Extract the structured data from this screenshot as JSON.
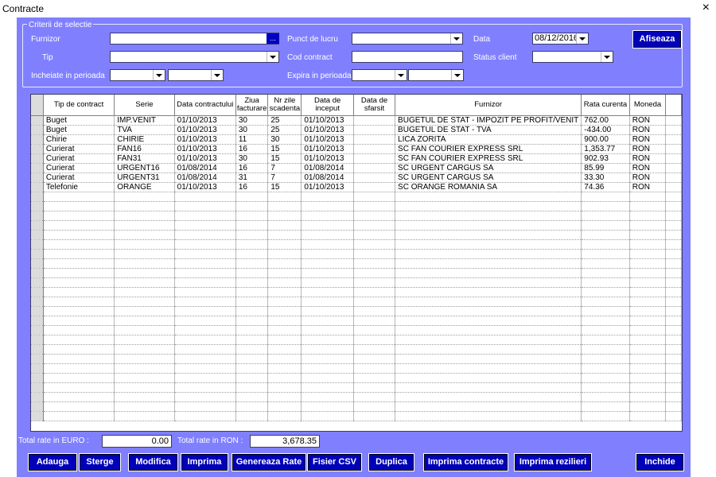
{
  "window": {
    "title": "Contracte",
    "close_symbol": "×"
  },
  "criteria": {
    "legend": "Criterii de selectie",
    "furnizor": {
      "label": "Furnizor",
      "value": "",
      "ellipsis": "..."
    },
    "punct_lucru": {
      "label": "Punct de lucru",
      "value": ""
    },
    "data": {
      "label": "Data",
      "value": "08/12/2016"
    },
    "tip": {
      "label": "Tip",
      "value": ""
    },
    "cod_contract": {
      "label": "Cod contract",
      "value": ""
    },
    "status_client": {
      "label": "Status client",
      "value": ""
    },
    "incheiate": {
      "label": "Incheiate in perioada",
      "from": "",
      "to": ""
    },
    "expira": {
      "label": "Expira in perioada",
      "from": "",
      "to": ""
    },
    "afiseaza_button": "Afiseaza"
  },
  "grid": {
    "columns": [
      "Tip de contract",
      "Serie",
      "Data contractului",
      "Ziua facturare",
      "Nr zile scadenta",
      "Data de inceput",
      "Data de sfarsit",
      "Furnizor",
      "Rata curenta",
      "Moneda"
    ],
    "rows": [
      [
        "Buget",
        "IMP.VENIT",
        "01/10/2013",
        "30",
        "25",
        "01/10/2013",
        "",
        "BUGETUL DE STAT - IMPOZIT PE PROFIT/VENIT",
        "762.00",
        "RON"
      ],
      [
        "Buget",
        "TVA",
        "01/10/2013",
        "30",
        "25",
        "01/10/2013",
        "",
        "BUGETUL DE STAT - TVA",
        "-434.00",
        "RON"
      ],
      [
        "Chirie",
        "CHIRIE",
        "01/10/2013",
        "11",
        "30",
        "01/10/2013",
        "",
        "LICA ZORITA",
        "900.00",
        "RON"
      ],
      [
        "Curierat",
        "FAN16",
        "01/10/2013",
        "16",
        "15",
        "01/10/2013",
        "",
        "SC FAN COURIER EXPRESS SRL",
        "1,353.77",
        "RON"
      ],
      [
        "Curierat",
        "FAN31",
        "01/10/2013",
        "30",
        "15",
        "01/10/2013",
        "",
        "SC FAN COURIER EXPRESS SRL",
        "902.93",
        "RON"
      ],
      [
        "Curierat",
        "URGENT16",
        "01/08/2014",
        "16",
        "7",
        "01/08/2014",
        "",
        "SC URGENT CARGUS SA",
        "85.99",
        "RON"
      ],
      [
        "Curierat",
        "URGENT31",
        "01/08/2014",
        "31",
        "7",
        "01/08/2014",
        "",
        "SC URGENT CARGUS SA",
        "33.30",
        "RON"
      ],
      [
        "Telefonie",
        "ORANGE",
        "01/10/2013",
        "16",
        "15",
        "01/10/2013",
        "",
        "SC ORANGE ROMANIA SA",
        "74.36",
        "RON"
      ]
    ]
  },
  "totals": {
    "euro_label": "Total rate in EURO :",
    "euro_value": "0.00",
    "ron_label": "Total rate in RON :",
    "ron_value": "3,678.35"
  },
  "buttons": {
    "adauga": "Adauga",
    "sterge": "Sterge",
    "modifica": "Modifica",
    "imprima": "Imprima",
    "genereaza": "Genereaza Rate",
    "fisier_csv": "Fisier CSV",
    "duplica": "Duplica",
    "imprima_contracte": "Imprima contracte",
    "imprima_rezilieri": "Imprima rezilieri",
    "inchide": "Inchide"
  },
  "colors": {
    "panel": "#8080ff",
    "button": "#0000b8"
  }
}
